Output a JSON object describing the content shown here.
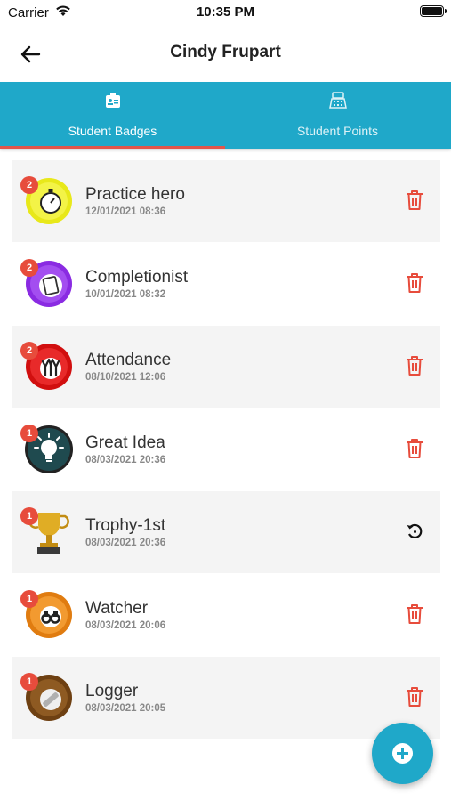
{
  "status_bar": {
    "carrier": "Carrier",
    "time": "10:35 PM"
  },
  "header": {
    "title": "Cindy Frupart",
    "back_icon": "arrow-left-icon"
  },
  "tabs": [
    {
      "label": "Student Badges",
      "icon": "id-badge-icon",
      "active": true
    },
    {
      "label": "Student Points",
      "icon": "cash-register-icon",
      "active": false
    }
  ],
  "colors": {
    "primary": "#1fa8c9",
    "tab_indicator": "#e2554a",
    "count_badge": "#e74c3c",
    "delete": "#e74c3c"
  },
  "badges": [
    {
      "name": "Practice hero",
      "date": "12/01/2021 08:36",
      "count": "2",
      "art": "stopwatch-badge",
      "color": "#e8e81a",
      "action": "delete"
    },
    {
      "name": "Completionist",
      "date": "10/01/2021 08:32",
      "count": "2",
      "art": "checklist-badge",
      "color": "#8a2be2",
      "action": "delete"
    },
    {
      "name": "Attendance",
      "date": "08/10/2021 12:06",
      "count": "2",
      "art": "raised-hands-badge",
      "color": "#e01010",
      "action": "delete"
    },
    {
      "name": "Great Idea",
      "date": "08/03/2021 20:36",
      "count": "1",
      "art": "lightbulb-badge",
      "color": "#1f4a4f",
      "action": "delete"
    },
    {
      "name": "Trophy-1st",
      "date": "08/03/2021 20:36",
      "count": "1",
      "art": "trophy-badge",
      "color": "#d9a21a",
      "action": "restore"
    },
    {
      "name": "Watcher",
      "date": "08/03/2021 20:06",
      "count": "1",
      "art": "binoculars-badge",
      "color": "#f08a1a",
      "action": "delete"
    },
    {
      "name": "Logger",
      "date": "08/03/2021 20:05",
      "count": "1",
      "art": "log-badge",
      "color": "#7a4a1a",
      "action": "delete"
    }
  ],
  "fab": {
    "icon": "plus-circle-icon"
  }
}
